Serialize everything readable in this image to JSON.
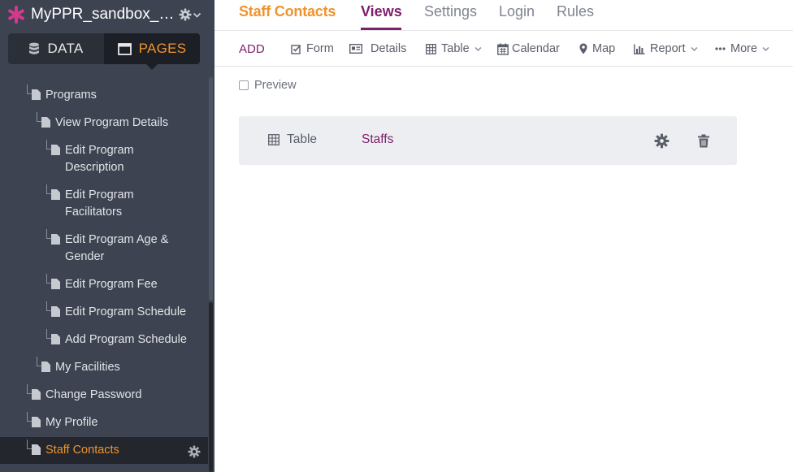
{
  "app": {
    "name": "MyPPR_sandbox_20..",
    "brand_color": "#d6398c",
    "accent_color": "#f0932b",
    "primary_color": "#7e1f6a"
  },
  "sidebar": {
    "tabs": [
      {
        "label": "DATA",
        "icon": "database-icon"
      },
      {
        "label": "PAGES",
        "icon": "window-icon",
        "active": true
      }
    ],
    "tree": [
      {
        "label": "Programs"
      },
      {
        "label": "View Program Details"
      },
      {
        "label_lines": [
          "Edit Program",
          "Description"
        ]
      },
      {
        "label_lines": [
          "Edit Program",
          "Facilitators"
        ]
      },
      {
        "label_lines": [
          "Edit Program Age &",
          "Gender"
        ]
      },
      {
        "label": "Edit Program Fee"
      },
      {
        "label": "Edit Program Schedule"
      },
      {
        "label": "Add Program Schedule"
      },
      {
        "label": "My Facilities"
      },
      {
        "label": "Change Password"
      },
      {
        "label": "My Profile"
      },
      {
        "label": "Staff Contacts",
        "active": true
      }
    ]
  },
  "header": {
    "page_title": "Staff Contacts",
    "tabs": [
      {
        "label": "Views",
        "active": true
      },
      {
        "label": "Settings"
      },
      {
        "label": "Login"
      },
      {
        "label": "Rules"
      }
    ]
  },
  "toolbar": {
    "add_label": "ADD",
    "items": [
      {
        "label": "Form",
        "icon": "form-icon"
      },
      {
        "label": "Details",
        "icon": "details-icon"
      },
      {
        "label": "Table",
        "icon": "table-icon",
        "dropdown": true
      },
      {
        "label": "Calendar",
        "icon": "calendar-icon"
      },
      {
        "label": "Map",
        "icon": "map-pin-icon"
      },
      {
        "label": "Report",
        "icon": "bar-chart-icon",
        "dropdown": true
      },
      {
        "label": "More",
        "icon": "more-dots-icon",
        "dropdown": true
      }
    ]
  },
  "preview": {
    "label": "Preview",
    "checked": false
  },
  "views": [
    {
      "type": "Table",
      "source": "Staffs"
    }
  ]
}
